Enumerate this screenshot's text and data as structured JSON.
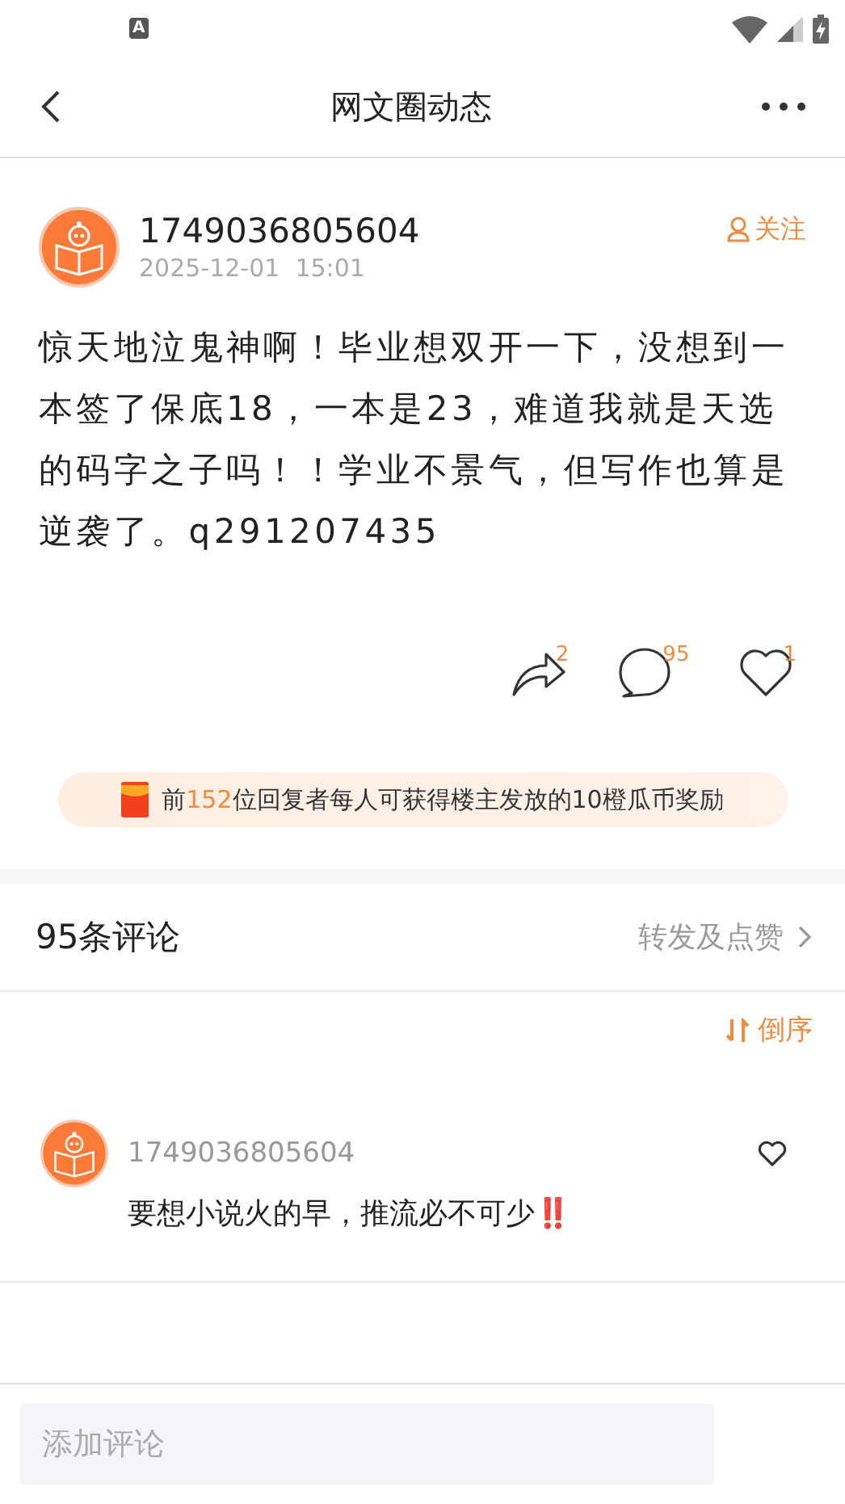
{
  "status_bar": {
    "notification_icon": "A"
  },
  "header": {
    "title": "网文圈动态"
  },
  "post": {
    "author": "1749036805604",
    "time": "2025-12-01  15:01",
    "follow_label": "关注",
    "text": "惊天地泣鬼神啊！毕业想双开一下，没想到一本签了保底18，一本是23，难道我就是天选的码字之子吗！！学业不景气，但写作也算是逆袭了。q291207435",
    "actions": [
      {
        "kind": "share",
        "count": "2"
      },
      {
        "kind": "comment",
        "count": "95"
      },
      {
        "kind": "like",
        "count": "1"
      }
    ],
    "reward": {
      "prefix": "前",
      "highlight": "152",
      "suffix": "位回复者每人可获得楼主发放的10橙瓜币奖励"
    }
  },
  "comments_header": {
    "title": "95条评论",
    "link": "转发及点赞"
  },
  "sort": {
    "label": "倒序"
  },
  "comments": [
    {
      "author": "1749036805604",
      "text": "要想小说火的早，推流必不可少",
      "emoji": "‼️",
      "liked": false
    }
  ],
  "comment_bar": {
    "placeholder": "添加评论"
  }
}
